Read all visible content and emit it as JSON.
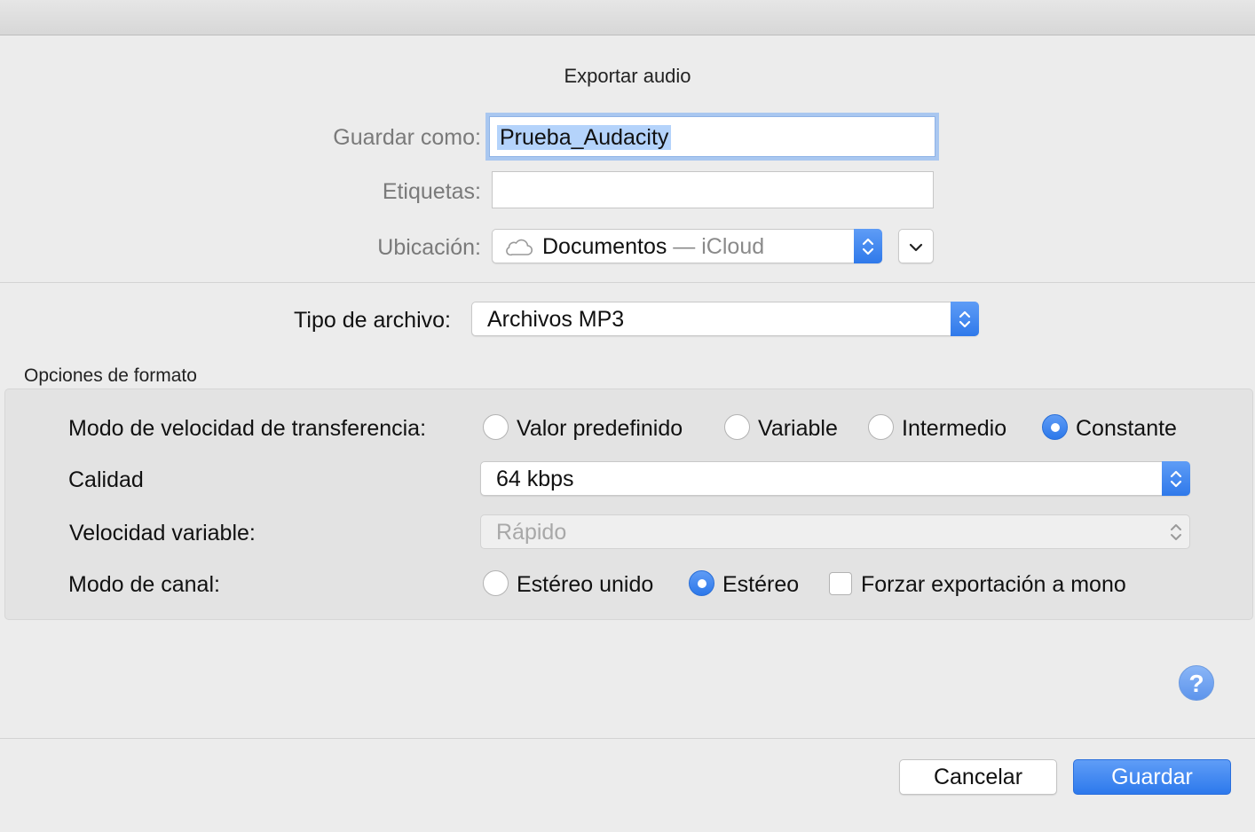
{
  "dialog": {
    "title": "Exportar audio",
    "save_as_label": "Guardar como:",
    "save_as_value": "Prueba_Audacity",
    "tags_label": "Etiquetas:",
    "tags_value": "",
    "location_label": "Ubicación:",
    "location_value": "Documentos",
    "location_suffix": " — iCloud",
    "file_type_label": "Tipo de archivo:",
    "file_type_value": "Archivos MP3"
  },
  "format_options": {
    "section_title": "Opciones de formato",
    "bitrate_mode_label": "Modo de velocidad de transferencia:",
    "bitrate_modes": [
      {
        "label": "Valor predefinido",
        "selected": false
      },
      {
        "label": "Variable",
        "selected": false
      },
      {
        "label": "Intermedio",
        "selected": false
      },
      {
        "label": "Constante",
        "selected": true
      }
    ],
    "quality_label": "Calidad",
    "quality_value": "64 kbps",
    "variable_speed_label": "Velocidad variable:",
    "variable_speed_value": "Rápido",
    "channel_mode_label": "Modo de canal:",
    "channel_modes": [
      {
        "label": "Estéreo unido",
        "selected": false
      },
      {
        "label": "Estéreo",
        "selected": true
      }
    ],
    "force_mono_label": "Forzar exportación a mono",
    "force_mono_checked": false
  },
  "buttons": {
    "help_glyph": "?",
    "cancel_label": "Cancelar",
    "save_label": "Guardar"
  },
  "colors": {
    "accent": "#2f79ea",
    "selection_highlight": "#b4d3fb",
    "focus_ring": "#a9c7f0"
  }
}
